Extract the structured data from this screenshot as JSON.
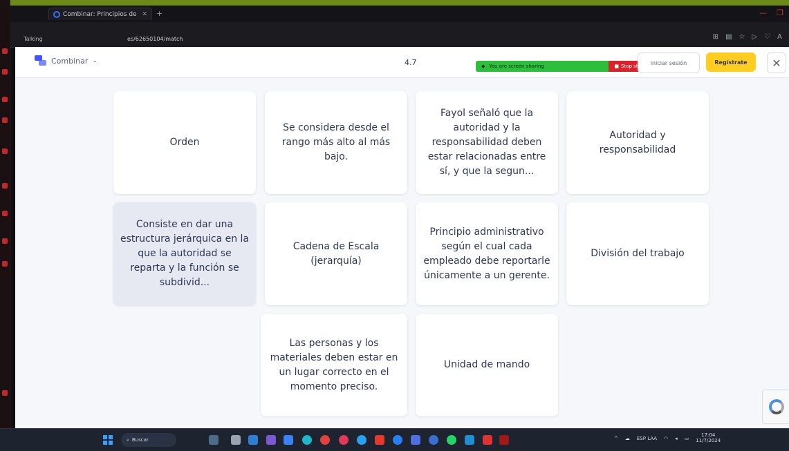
{
  "browser": {
    "tab_title": "Combinar: Principios de la",
    "left_label": "Talking",
    "url": "es/62650104/match"
  },
  "header": {
    "mode_label": "Combinar",
    "timer": "4.7",
    "share_text": "You are screen sharing",
    "stop_share": "Stop share",
    "login_label": "iniciar sesión",
    "signup_label": "Regístrate",
    "close_icon": "close-icon"
  },
  "cards": [
    {
      "text": "Orden",
      "selected": false
    },
    {
      "text": "Se considera desde el rango más alto al más bajo.",
      "selected": false
    },
    {
      "text": "Fayol señaló que la autoridad y la responsabilidad deben estar relacionadas entre sí, y que la segun...",
      "selected": false
    },
    {
      "text": "Autoridad y responsabilidad",
      "selected": false
    },
    {
      "text": "Consiste en dar una estructura jerárquica en la que la autoridad se reparta y la función se subdivid...",
      "selected": true
    },
    {
      "text": "Cadena de Escala (jerarquía)",
      "selected": false
    },
    {
      "text": "Principio administrativo según el cual cada empleado debe reportarle únicamente a un gerente.",
      "selected": false
    },
    {
      "text": "División del trabajo",
      "selected": false
    },
    {
      "text": "Las personas y los materiales deben estar en un lugar correcto en el momento preciso.",
      "selected": false
    },
    {
      "text": "Unidad de mando",
      "selected": false
    }
  ],
  "taskbar": {
    "search_label": "Buscar",
    "tray_lang": "ESP LAA",
    "clock_time": "17:04",
    "clock_date": "11/7/2024"
  },
  "colors": {
    "accent": "#4255ff",
    "signup": "#ffcd1f",
    "card_text": "#2e3856",
    "page_bg": "#f6f7fb"
  }
}
